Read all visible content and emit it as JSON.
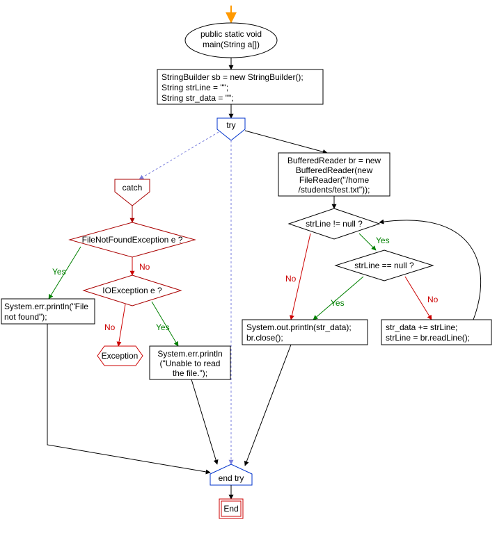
{
  "chart_data": {
    "type": "flowchart",
    "title": "",
    "nodes": {
      "start_arrow": "",
      "main_decl": "public static void\nmain(String a[])",
      "init_block": "StringBuilder sb = new StringBuilder();\nString strLine = \"\";\nString str_data = \"\";",
      "try_label": "try",
      "catch_label": "catch",
      "fnfe_q": "FileNotFoundException e ?",
      "ioe_q": "IOException e ?",
      "file_not_found": "System.err.println(\"File\nnot found\");",
      "exception": "Exception",
      "unable_read": "System.err.println\n(\"Unable to read\nthe file.\");",
      "buffered_reader": "BufferedReader br = new\nBufferedReader(new\nFileReader(\"/home\n/students/test.txt\"));",
      "strline_nn": "strLine != null ?",
      "strline_null": "strLine == null ?",
      "print_close": "System.out.println(str_data);\nbr.close();",
      "append_read": "str_data += strLine;\nstrLine = br.readLine();",
      "end_try": "end try",
      "end_label": "End"
    },
    "edge_labels": {
      "yes": "Yes",
      "no": "No"
    },
    "colors": {
      "node_stroke": "#000000",
      "try_stroke": "#0033cc",
      "catch_stroke": "#aa0000",
      "end_stroke": "#cc0000",
      "start_arrow": "#ff9900",
      "yes": "#008000",
      "no": "#cc0000",
      "dotted": "#7a7fdd"
    }
  }
}
